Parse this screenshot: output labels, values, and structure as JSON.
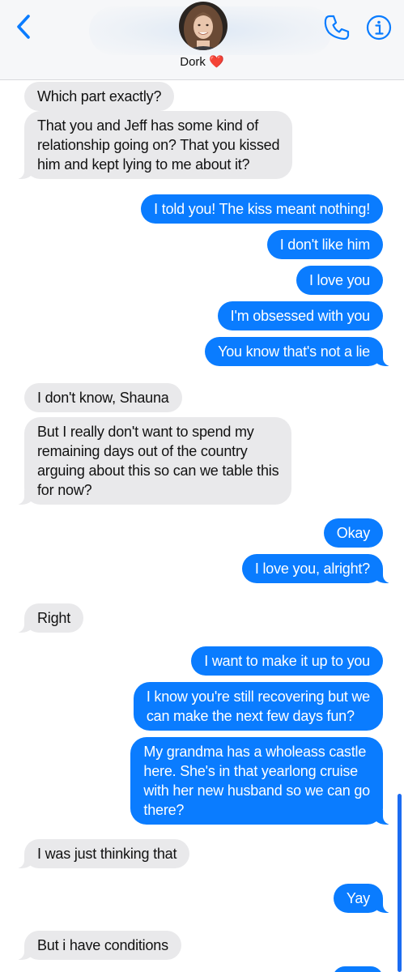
{
  "header": {
    "contact_name": "Dork",
    "heart": "❤️",
    "icons": {
      "back": "chevron-left-icon",
      "call": "phone-icon",
      "info": "info-icon"
    },
    "accent_color": "#0a7cff"
  },
  "colors": {
    "incoming_bubble": "#e9e9eb",
    "outgoing_bubble": "#0a7cff",
    "header_bg": "#f6f7f9"
  },
  "messages": [
    {
      "dir": "in",
      "text": "Which part exactly?"
    },
    {
      "dir": "in",
      "text": "That you and Jeff has some kind of\nrelationship going on? That you kissed\nhim and kept lying to me about it?"
    },
    {
      "dir": "out",
      "text": "I told you! The kiss meant nothing!"
    },
    {
      "dir": "out",
      "text": "I don't like him"
    },
    {
      "dir": "out",
      "text": "I love you"
    },
    {
      "dir": "out",
      "text": "I'm obsessed with you"
    },
    {
      "dir": "out",
      "text": "You know that's not a lie"
    },
    {
      "dir": "in",
      "text": "I don't know, Shauna"
    },
    {
      "dir": "in",
      "text": "But I really don't want to spend my\nremaining days out of the country\narguing about this so can we table this\nfor now?"
    },
    {
      "dir": "out",
      "text": "Okay"
    },
    {
      "dir": "out",
      "text": "I love you, alright?"
    },
    {
      "dir": "in",
      "text": "Right"
    },
    {
      "dir": "out",
      "text": "I want to make it up to you"
    },
    {
      "dir": "out",
      "text": "I know you're still recovering but we\ncan make the next few days fun?"
    },
    {
      "dir": "out",
      "text": "My grandma has a wholeass castle\nhere. She's in that yearlong cruise\nwith her new husband so we can go\nthere?"
    },
    {
      "dir": "in",
      "text": "I was just thinking that"
    },
    {
      "dir": "out",
      "text": "Yay"
    },
    {
      "dir": "in",
      "text": "But i have conditions"
    }
  ]
}
